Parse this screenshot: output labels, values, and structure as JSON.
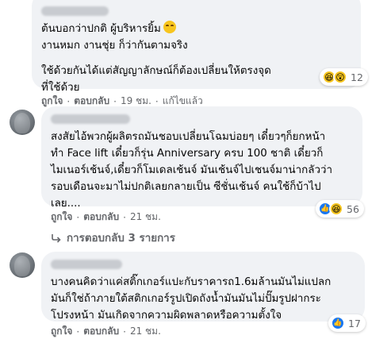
{
  "comments": [
    {
      "lines": [
        "ต้นบอกว่าปกติ ผู้บริหารยิ้ม",
        "งานหมก งานชุ่ย ก็ว่ากันตามจริง",
        "ใช้ด้วยกันได้แต่สัญญาลักษณ์ก็ต้องเปลี่ยนให้ตรงจุด",
        "ที่ใช้ด้วย"
      ],
      "reactions": {
        "icons": [
          "haha-icon",
          "wow-icon"
        ],
        "count": "12"
      },
      "actions": {
        "like": "ถูกใจ",
        "reply": "ตอบกลับ",
        "time": "19 ชม.",
        "edited": "แก้ไขแล้ว"
      }
    },
    {
      "lines": [
        "สงสัยไอ้พวกผู้ผลิตรถมันชอบเปลี่ยนโฉมบ่อยๆ เดี๋ยวๆก็ยกหน้า",
        "ทำ Face lift เดี๋ยวก็รุ่น Anniversary ครบ 100 ชาติ เดี๋ยวก็",
        "ไมเนอร์เช้นจ์,เดี๋ยวก็โมเดลเช้นจ์ มันเช้นจ์ไปเชนจ์มาน่ากลัวว่า",
        "รอบเดือนจะมาไม่ปกติเลยกลายเป็น ซีชั่นเช้นจ์ คนใช้ก็บ้าไป",
        "เลย...."
      ],
      "reactions": {
        "icons": [
          "like-icon",
          "haha-icon"
        ],
        "count": "56"
      },
      "actions": {
        "like": "ถูกใจ",
        "reply": "ตอบกลับ",
        "time": "21 ชม."
      },
      "replies_label": "การตอบกลับ 3 รายการ"
    },
    {
      "lines": [
        "บางคนคิดว่าแค่สติ๊กเกอร์แปะกับราคารถ1.6มล้านมันไม่แปลก",
        "มันก็ใช่ถ้าภายใต้สติกเกอร์รูปเปิดถังน้ำมันมันไม่ปั๊มรูปฝากระ",
        "โปรงหน้า มันเกิดจากความผิดพลาดหรือความตั้งใจ"
      ],
      "reactions": {
        "icons": [
          "like-icon"
        ],
        "count": "17"
      },
      "actions": {
        "like": "ถูกใจ",
        "reply": "ตอบกลับ",
        "time": "21 ชม."
      }
    }
  ]
}
